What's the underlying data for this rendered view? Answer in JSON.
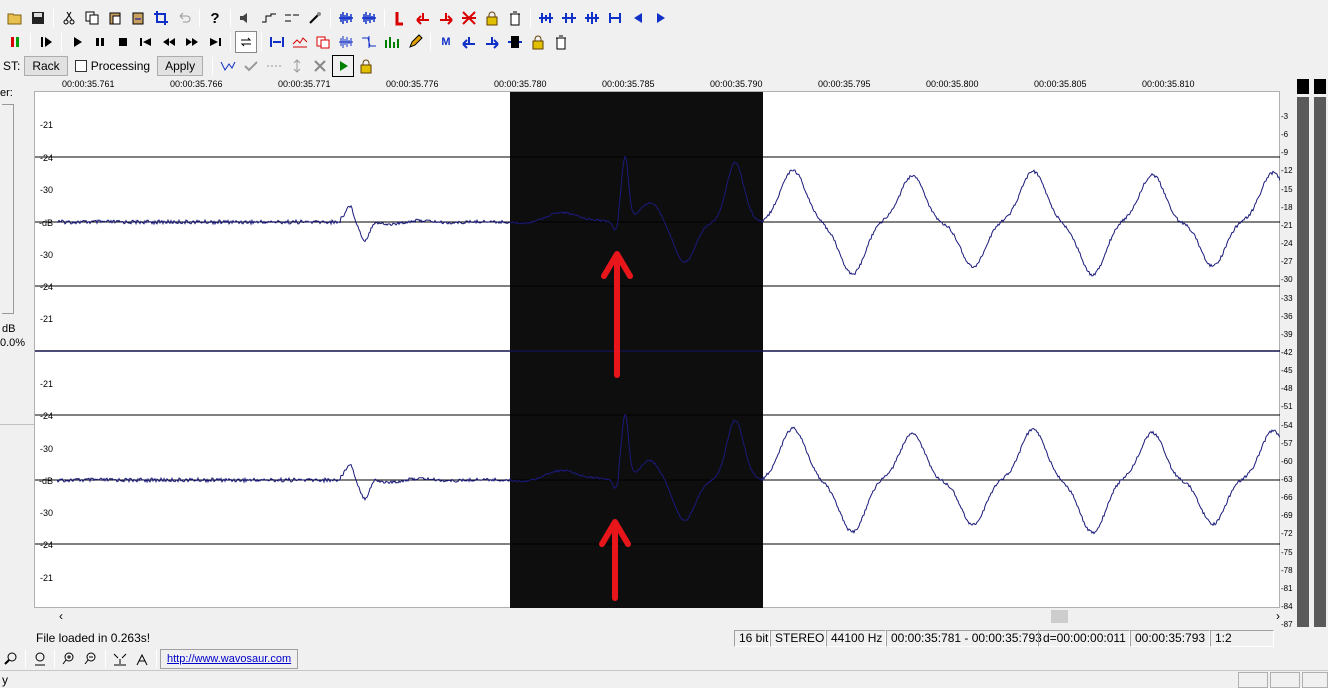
{
  "toolbar_row1": {
    "icons": [
      "open-folder-icon",
      "save-icon",
      "cut-icon",
      "copy-icon",
      "paste-icon",
      "paste-mix-icon",
      "crop-icon",
      "undo-icon",
      "help-icon",
      "volume-icon",
      "envelope-icon",
      "normalize-icon",
      "dc-offset-icon",
      "wave-zoom-icon",
      "wave-zoom-out-icon",
      "marker-start-icon",
      "marker-left-icon",
      "marker-right-icon",
      "marker-delete-all-icon",
      "lock-icon",
      "trash-icon",
      "loop-a-icon",
      "loop-b-icon",
      "loop-c-icon",
      "loop-d-icon",
      "prev-icon",
      "next-icon"
    ]
  },
  "toolbar_row2": {
    "icons": [
      "meter-icon",
      "play-from-start-icon",
      "play-icon",
      "pause-icon",
      "stop-icon",
      "rewind-start-icon",
      "rewind-icon",
      "fast-forward-icon",
      "forward-end-icon",
      "loop-icon",
      "select-wave-icon",
      "graph-icon",
      "record-icon",
      "spectrum-icon",
      "filter-icon",
      "equalizer-icon",
      "pencil-icon",
      "marker-m-icon",
      "marker-left-blue-icon",
      "marker-right-blue-icon",
      "region-icon",
      "lock-icon",
      "trash-icon"
    ]
  },
  "toolbar_row3": {
    "vst_label": "ST:",
    "rack_label": "Rack",
    "processing_label": "Processing",
    "apply_label": "Apply",
    "icons": [
      "wave-edit-icon",
      "check-icon",
      "dots-icon",
      "arrows-icon",
      "close-icon",
      "play-region-icon",
      "lock-icon"
    ]
  },
  "left_panel": {
    "top_label": "er:",
    "db_label": "dB",
    "percent_label": "0.0%"
  },
  "ruler": {
    "ticks": [
      "00:00:35.761",
      "00:00:35.766",
      "00:00:35.771",
      "00:00:35.776",
      "00:00:35.780",
      "00:00:35.785",
      "00:00:35.790",
      "00:00:35.795",
      "00:00:35.800",
      "00:00:35.805",
      "00:00:35.810"
    ]
  },
  "channel_labels": {
    "top": [
      "-21",
      "-24",
      "-30",
      "-dB",
      "-30",
      "-24",
      "-21"
    ],
    "bottom": [
      "-21",
      "-24",
      "-30",
      "-dB",
      "-30",
      "-24",
      "-21"
    ]
  },
  "meter": {
    "scale": [
      "-3",
      "-6",
      "-9",
      "-12",
      "-15",
      "-18",
      "-21",
      "-24",
      "-27",
      "-30",
      "-33",
      "-36",
      "-39",
      "-42",
      "-45",
      "-48",
      "-51",
      "-54",
      "-57",
      "-60",
      "-63",
      "-66",
      "-69",
      "-72",
      "-75",
      "-78",
      "-81",
      "-84",
      "-87"
    ]
  },
  "status": {
    "message": "File loaded in 0.263s!",
    "bits": "16 bit",
    "channels": "STEREO",
    "rate": "44100 Hz",
    "selection": "00:00:35:781 - 00:00:35:793",
    "duration": "d=00:00:00:011",
    "position": "00:00:35:793",
    "zoom": "1:2"
  },
  "bottom": {
    "link": "http://www.wavosaur.com",
    "icons": [
      "zoom-in-icon",
      "zoom-fit-icon",
      "zoom-in-h-icon",
      "zoom-out-h-icon",
      "zoom-sel-icon",
      "zoom-full-icon"
    ],
    "corner_text": "y"
  },
  "colors": {
    "waveform": "#1a1a7a",
    "selection_bg": "#0e0e0e",
    "annotation_arrow": "#e8161b",
    "marker_red": "#d80000",
    "marker_blue": "#1030c8"
  }
}
